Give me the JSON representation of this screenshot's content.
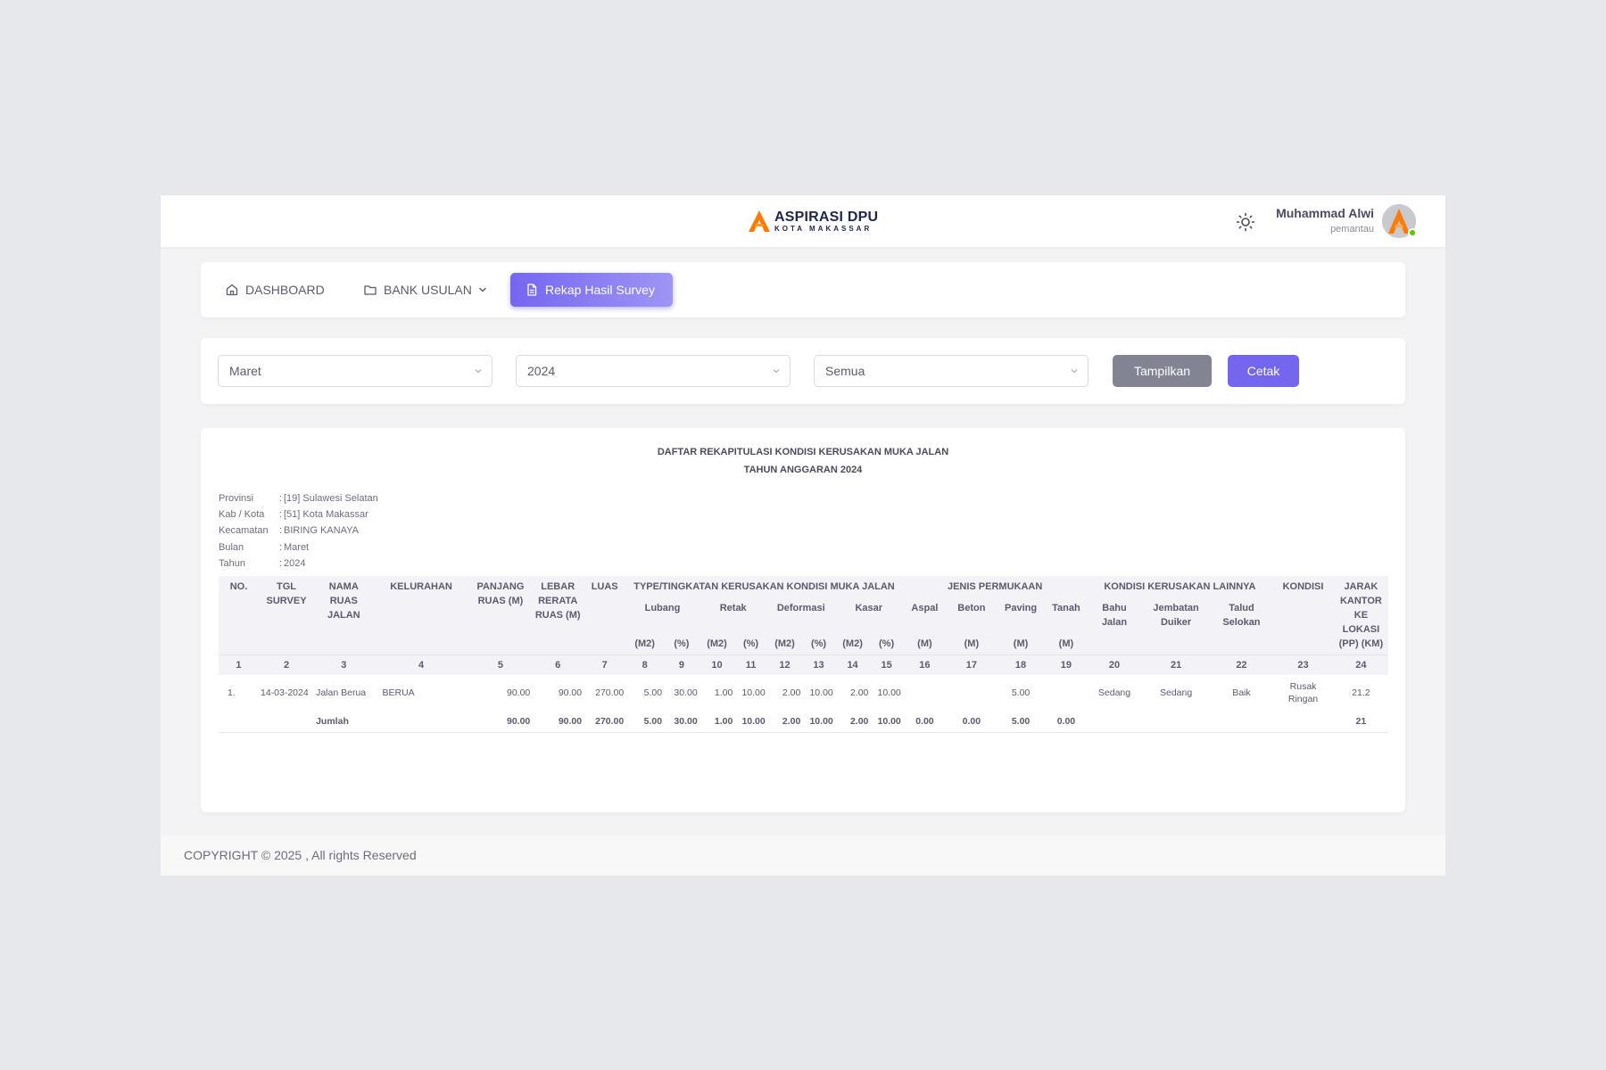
{
  "brand": {
    "name": "ASPIRASI DPU",
    "sub": "KOTA MAKASSAR"
  },
  "user": {
    "name": "Muhammad Alwi",
    "role": "pemantau"
  },
  "nav": {
    "dashboard": "DASHBOARD",
    "bank_usulan": "BANK USULAN",
    "rekap": "Rekap Hasil Survey"
  },
  "filters": {
    "bulan": "Maret",
    "tahun": "2024",
    "status": "Semua",
    "tampilkan": "Tampilkan",
    "cetak": "Cetak"
  },
  "report": {
    "title1": "DAFTAR REKAPITULASI KONDISI KERUSAKAN MUKA JALAN",
    "title2": "TAHUN ANGGARAN 2024",
    "meta": [
      {
        "label": "Provinsi",
        "value": "[19] Sulawesi Selatan"
      },
      {
        "label": "Kab / Kota",
        "value": "[51] Kota Makassar"
      },
      {
        "label": "Kecamatan",
        "value": "BIRING KANAYA"
      },
      {
        "label": "Bulan",
        "value": "Maret"
      },
      {
        "label": "Tahun",
        "value": "2024"
      }
    ],
    "meta_sep": ":",
    "headers": {
      "no": "NO.",
      "tgl": "TGL SURVEY",
      "nama": "NAMA RUAS JALAN",
      "kelurahan": "KELURAHAN",
      "panjang": "PANJANG RUAS (M)",
      "lebar": "LEBAR RERATA RUAS (M)",
      "luas": "LUAS",
      "type": "TYPE/TINGKATAN KERUSAKAN KONDISI MUKA JALAN",
      "jenis": "JENIS PERMUKAAN",
      "kondisi_lain": "KONDISI KERUSAKAN LAINNYA",
      "kondisi": "KONDISI",
      "jarak": "JARAK KANTOR KE LOKASI (PP) (KM)",
      "lubang": "Lubang",
      "retak": "Retak",
      "deformasi": "Deformasi",
      "kasar": "Kasar",
      "aspal": "Aspal",
      "beton": "Beton",
      "paving": "Paving",
      "tanah": "Tanah",
      "bahu": "Bahu Jalan",
      "jembatan": "Jembatan Duiker",
      "talud": "Talud Selokan",
      "m2": "(M2)",
      "pct": "(%)",
      "m": "(M)"
    },
    "col_numbers": [
      "1",
      "2",
      "3",
      "4",
      "5",
      "6",
      "7",
      "8",
      "9",
      "10",
      "11",
      "12",
      "13",
      "14",
      "15",
      "16",
      "17",
      "18",
      "19",
      "20",
      "21",
      "22",
      "23",
      "24"
    ],
    "row": {
      "no": "1.",
      "tgl": "14-03-2024",
      "nama": "Jalan Berua",
      "kelurahan": "BERUA",
      "panjang": "90.00",
      "lebar": "90.00",
      "luas": "270.00",
      "lubang_m2": "5.00",
      "lubang_pct": "30.00",
      "retak_m2": "1.00",
      "retak_pct": "10.00",
      "deformasi_m2": "2.00",
      "deformasi_pct": "10.00",
      "kasar_m2": "2.00",
      "kasar_pct": "10.00",
      "aspal": "",
      "beton": "",
      "paving": "5.00",
      "tanah": "",
      "bahu": "Sedang",
      "jembatan": "Sedang",
      "talud": "Baik",
      "kondisi": "Rusak Ringan",
      "jarak": "21.2"
    },
    "total": {
      "label": "Jumlah",
      "panjang": "90.00",
      "lebar": "90.00",
      "luas": "270.00",
      "lubang_m2": "5.00",
      "lubang_pct": "30.00",
      "retak_m2": "1.00",
      "retak_pct": "10.00",
      "deformasi_m2": "2.00",
      "deformasi_pct": "10.00",
      "kasar_m2": "2.00",
      "kasar_pct": "10.00",
      "aspal": "0.00",
      "beton": "0.00",
      "paving": "5.00",
      "tanah": "0.00",
      "jarak": "21"
    }
  },
  "footer": {
    "copyright": "COPYRIGHT © 2025 , All rights Reserved"
  },
  "colors": {
    "primary": "#7367f0",
    "secondary": "#828393",
    "brand_orange": "#ff7a00",
    "online": "#56ca00"
  },
  "icons": {
    "theme": "sun-icon",
    "dashboard": "home-icon",
    "bank": "folder-icon",
    "rekap": "file-icon",
    "select": "chevron-down-icon"
  }
}
